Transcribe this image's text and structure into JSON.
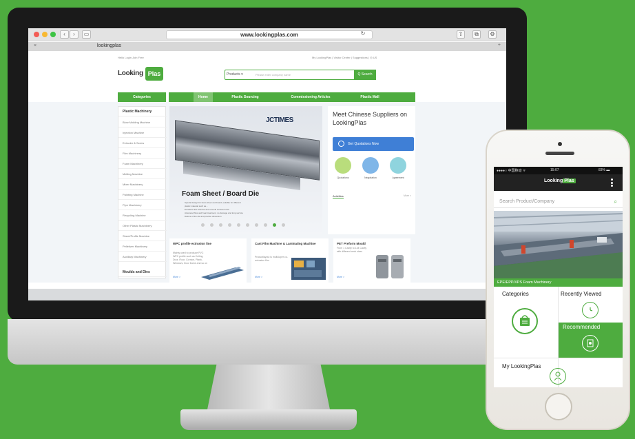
{
  "browser": {
    "url": "www.lookingplas.com",
    "tab_title": "lookingplas",
    "tab_close": "×",
    "tab_new": "+",
    "back": "‹",
    "forward": "›",
    "traffic_colors": [
      "#f35c55",
      "#f8b932",
      "#3ec445"
    ]
  },
  "site": {
    "top_links_left": "Hello  Login  Join Free",
    "top_links_right": "My LookingPlas  |  Visitor Center  |  Suggestions  |  ◎ US",
    "logo_word": "Looking",
    "logo_badge": "Plas",
    "search": {
      "category": "Products ▾",
      "placeholder": "Please enter company name",
      "button": "Q Search"
    },
    "categories_tab": "Categories",
    "nav": [
      "Home",
      "Plastic Sourcing",
      "Commissioning Articles",
      "Plastic Mall"
    ],
    "sidebar": [
      "Plastic Machinery",
      "Blow Molding Machine",
      "Injection Machine",
      "Extruder & Screw",
      "Film Machinery",
      "Foam Machinery",
      "Melting Machine",
      "Mixer Machinery",
      "Painting Machine",
      "Pipe Machinery",
      "Recycling Machine",
      "Other Plastic Machinery",
      "Sheet/Profile Machine",
      "Pelletizer Machinery",
      "Auxiliary Machinery",
      "Moulds and Dies"
    ],
    "hero": {
      "brand": "JCTIMES",
      "title": "Foam Sheet / Board Die",
      "bullets": [
        "Special design for foam sheet and board, suitable for different",
        "plastic material such as...",
        "Excellent flow channel and smooth surface finish",
        "Advanced flow and heat treatment, no damage and long service",
        "lifetime of the die and precise dimension"
      ]
    },
    "right_panel": {
      "title": "Meet Chinese Suppliers on LookingPlas",
      "quote_button": "Get Quotations Now",
      "circles": [
        "Quotations",
        "Negotiation",
        "Agreement"
      ],
      "activities": "Activities",
      "more": "More >"
    },
    "cards": [
      {
        "title": "WPC profile extrusion line",
        "desc": "Mainly used to produce PVC WPC profile such as Ceiling, Door, Floor, Cornice, Plank, Windows, Door frame and so on",
        "more": "More >"
      },
      {
        "title": "Cast Film Machine & Laminating Machine",
        "desc": "Productlayout is multi-layer co-extrusion film",
        "more": "More >"
      },
      {
        "title": "PET Preform Mould",
        "desc": "From 1 Cavity to 144 Cavity with different neck sizes",
        "more": "More >"
      }
    ]
  },
  "phone": {
    "status_left": "●●●●○ 中国移动 ᯤ",
    "status_time": "15:07",
    "status_right": "83% ▬",
    "logo_word": "Looking",
    "logo_badge": "Plas",
    "search_placeholder": "Search Product/Company",
    "search_icon": "⌕",
    "banner_caption": "EPE/EPP/XPS Foam Machinery",
    "tiles": {
      "categories": "Categories",
      "recent": "Recently Viewed",
      "recommended": "Recommended",
      "my": "My LookingPlas"
    }
  },
  "colors": {
    "brand_green": "#4eac3f",
    "accent_blue": "#3f7fd6",
    "circle_green": "#b9dd7c",
    "circle_blue": "#7fb6e8",
    "circle_teal": "#8fd4de"
  }
}
